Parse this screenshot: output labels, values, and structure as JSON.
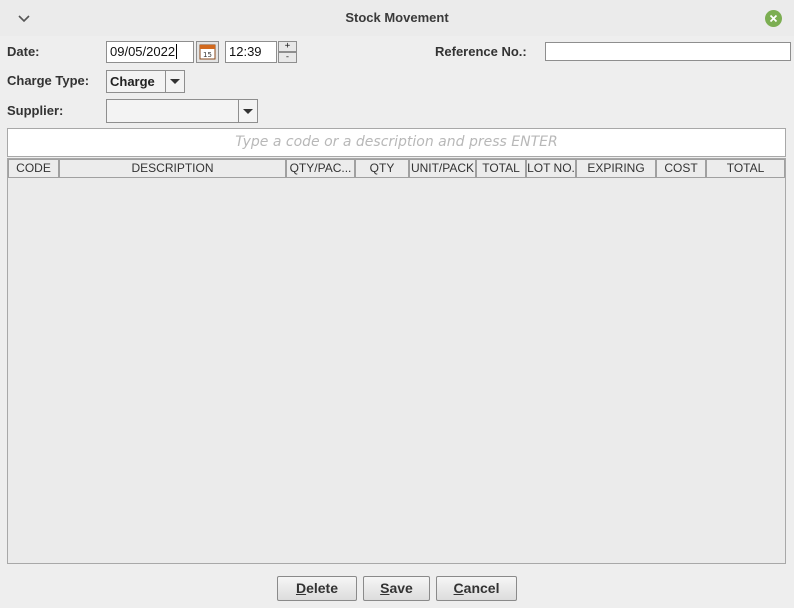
{
  "window": {
    "title": "Stock Movement",
    "menu_icon": "chevron-down-icon",
    "close_icon": "close-icon",
    "close_color": "#7cae52"
  },
  "form": {
    "date_label": "Date:",
    "date_value": "09/05/2022",
    "calendar_icon": "calendar-icon",
    "time_value": "12:39",
    "spinner_up": "+",
    "spinner_down": "-",
    "reference_label": "Reference No.:",
    "reference_value": "",
    "charge_type_label": "Charge Type:",
    "charge_type_value": "Charge",
    "supplier_label": "Supplier:",
    "supplier_value": ""
  },
  "search": {
    "placeholder": "Type a code or a description and press ENTER"
  },
  "table": {
    "columns": [
      "CODE",
      "DESCRIPTION",
      "QTY/PAC...",
      "QTY",
      "UNIT/PACK",
      "TOTAL",
      "LOT NO.",
      "EXPIRING",
      "COST",
      "TOTAL"
    ],
    "rows": []
  },
  "actions": {
    "delete_mnemonic": "D",
    "delete_rest": "elete",
    "save_mnemonic": "S",
    "save_rest": "ave",
    "cancel_mnemonic": "C",
    "cancel_rest": "ancel"
  }
}
